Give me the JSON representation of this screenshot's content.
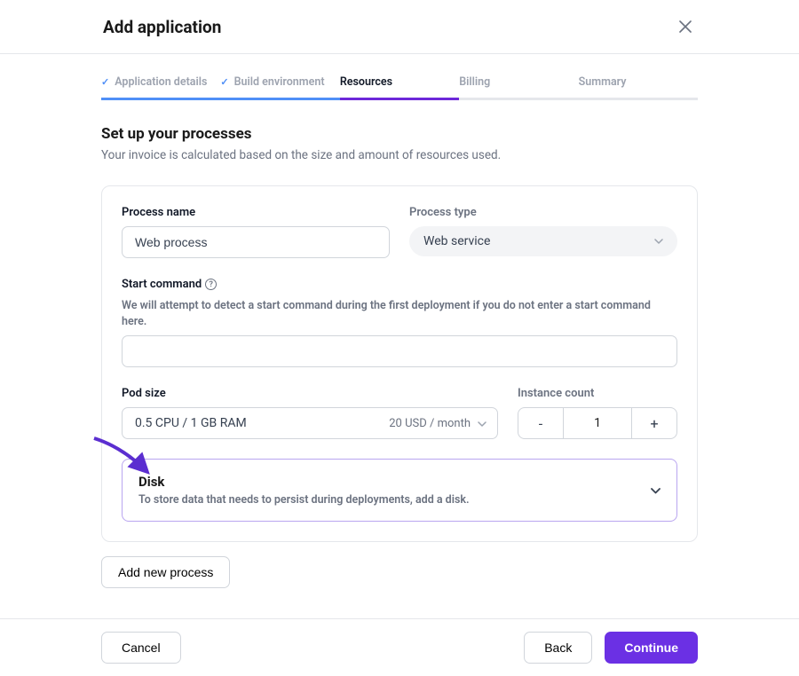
{
  "header": {
    "title": "Add application"
  },
  "stepper": {
    "steps": [
      {
        "label": "Application details",
        "done": true
      },
      {
        "label": "Build environment",
        "done": true
      },
      {
        "label": "Resources",
        "active": true
      },
      {
        "label": "Billing"
      },
      {
        "label": "Summary"
      }
    ]
  },
  "section": {
    "title": "Set up your processes",
    "subtitle": "Your invoice is calculated based on the size and amount of resources used."
  },
  "form": {
    "processName": {
      "label": "Process name",
      "value": "Web process"
    },
    "processType": {
      "label": "Process type",
      "value": "Web service"
    },
    "startCommand": {
      "label": "Start command",
      "help": "We will attempt to detect a start command during the first deployment if you do not enter a start command here.",
      "value": ""
    },
    "podSize": {
      "label": "Pod size",
      "value": "0.5 CPU / 1 GB RAM",
      "price": "20 USD / month"
    },
    "instanceCount": {
      "label": "Instance count",
      "value": "1",
      "minus": "-",
      "plus": "+"
    },
    "disk": {
      "title": "Disk",
      "subtitle": "To store data that needs to persist during deployments, add a disk."
    }
  },
  "buttons": {
    "addProcess": "Add new process",
    "cancel": "Cancel",
    "back": "Back",
    "continue": "Continue"
  }
}
